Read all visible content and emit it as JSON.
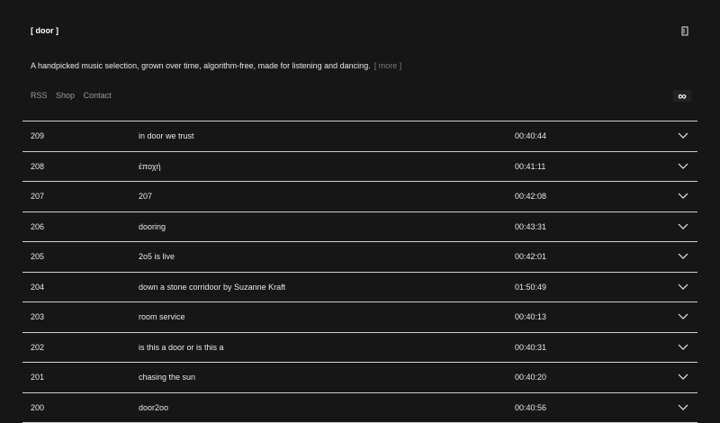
{
  "header": {
    "brand": "[ door ]",
    "icon": "audio-file-icon"
  },
  "description": {
    "text": "A handpicked music selection, grown over time, algorithm-free, made for listening and dancing.",
    "more_label": "[ more ]"
  },
  "nav": {
    "items": [
      "RSS",
      "Shop",
      "Contact"
    ]
  },
  "loop_button": {
    "label": "∞"
  },
  "episodes": [
    {
      "number": "209",
      "title": "in door we trust",
      "duration": "00:40:44"
    },
    {
      "number": "208",
      "title": "έποχή",
      "duration": "00:41:11"
    },
    {
      "number": "207",
      "title": "207",
      "duration": "00:42:08"
    },
    {
      "number": "206",
      "title": "dooring",
      "duration": "00:43:31"
    },
    {
      "number": "205",
      "title": "2o5 is live",
      "duration": "00:42:01"
    },
    {
      "number": "204",
      "title": "down a stone corridoor by Suzanne Kraft",
      "duration": "01:50:49"
    },
    {
      "number": "203",
      "title": "room service",
      "duration": "00:40:13"
    },
    {
      "number": "202",
      "title": "is this a door or is this a",
      "duration": "00:40:31"
    },
    {
      "number": "201",
      "title": "chasing the sun",
      "duration": "00:40:20"
    },
    {
      "number": "200",
      "title": "door2oo",
      "duration": "00:40:56"
    }
  ]
}
